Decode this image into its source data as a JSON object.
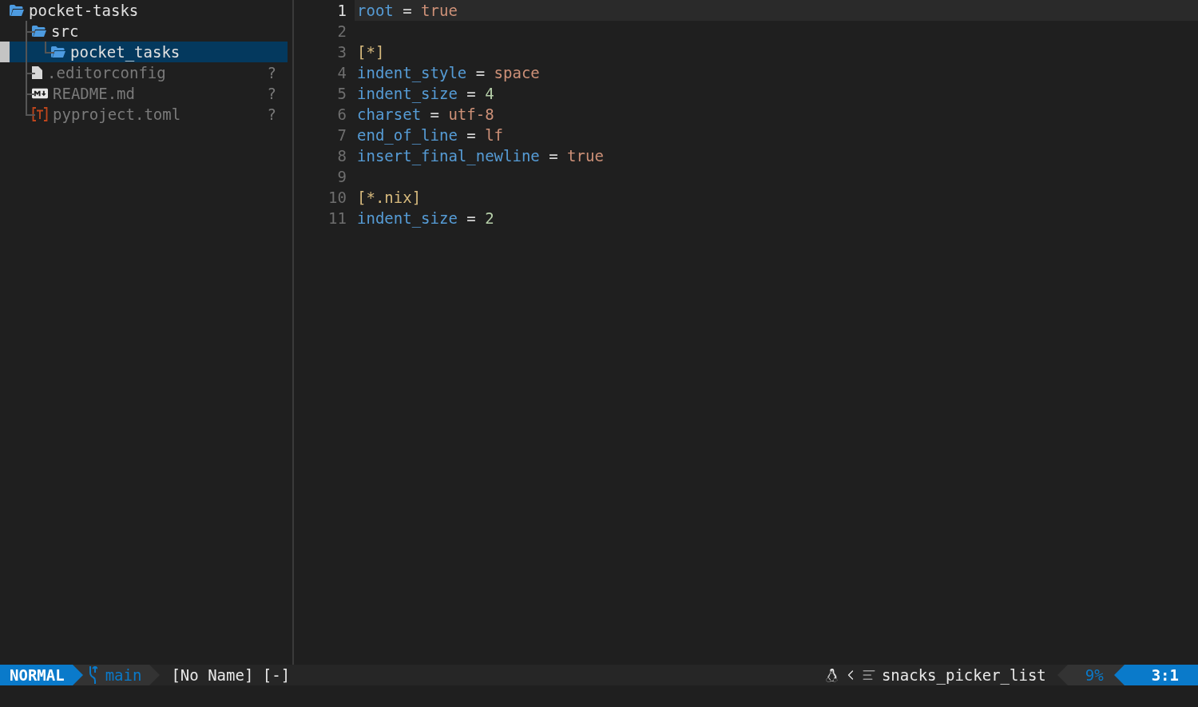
{
  "explorer": {
    "tree": [
      {
        "label": "pocket-tasks",
        "kind": "folder",
        "selected": false,
        "children": [
          {
            "label": "src",
            "kind": "folder",
            "selected": false,
            "children": [
              {
                "label": "pocket_tasks",
                "kind": "folder",
                "selected": true
              }
            ]
          },
          {
            "label": ".editorconfig",
            "kind": "file",
            "selected": false,
            "status": "?"
          },
          {
            "label": "README.md",
            "kind": "markdown",
            "selected": false,
            "status": "?"
          },
          {
            "label": "pyproject.toml",
            "kind": "toml",
            "selected": false,
            "status": "?"
          }
        ]
      }
    ]
  },
  "editor": {
    "lines": [
      {
        "number": "1",
        "current": true,
        "tokens": [
          {
            "kind": "key",
            "text": "root"
          },
          {
            "kind": "op",
            "text": " = "
          },
          {
            "kind": "string",
            "text": "true"
          }
        ]
      },
      {
        "number": "2",
        "current": false
      },
      {
        "number": "3",
        "current": false,
        "tokens": [
          {
            "kind": "section",
            "text": "[*]"
          }
        ]
      },
      {
        "number": "4",
        "current": false,
        "tokens": [
          {
            "kind": "key",
            "text": "indent_style"
          },
          {
            "kind": "op",
            "text": " = "
          },
          {
            "kind": "string",
            "text": "space"
          }
        ]
      },
      {
        "number": "5",
        "current": false,
        "tokens": [
          {
            "kind": "key",
            "text": "indent_size"
          },
          {
            "kind": "op",
            "text": " = "
          },
          {
            "kind": "number",
            "text": "4"
          }
        ]
      },
      {
        "number": "6",
        "current": false,
        "tokens": [
          {
            "kind": "key",
            "text": "charset"
          },
          {
            "kind": "op",
            "text": " = "
          },
          {
            "kind": "string",
            "text": "utf-8"
          }
        ]
      },
      {
        "number": "7",
        "current": false,
        "tokens": [
          {
            "kind": "key",
            "text": "end_of_line"
          },
          {
            "kind": "op",
            "text": " = "
          },
          {
            "kind": "string",
            "text": "lf"
          }
        ]
      },
      {
        "number": "8",
        "current": false,
        "tokens": [
          {
            "kind": "key",
            "text": "insert_final_newline"
          },
          {
            "kind": "op",
            "text": " = "
          },
          {
            "kind": "string",
            "text": "true"
          }
        ]
      },
      {
        "number": "9",
        "current": false
      },
      {
        "number": "10",
        "current": false,
        "tokens": [
          {
            "kind": "section",
            "text": "[*.nix]"
          }
        ]
      },
      {
        "number": "11",
        "current": false,
        "tokens": [
          {
            "kind": "key",
            "text": "indent_size"
          },
          {
            "kind": "op",
            "text": " = "
          },
          {
            "kind": "number",
            "text": "2"
          }
        ]
      }
    ]
  },
  "status_bar": {
    "mode": "NORMAL",
    "branch": "main",
    "file": "[No Name] [-]",
    "filetype": "snacks_picker_list",
    "progress": "9%",
    "position": "3:1"
  }
}
